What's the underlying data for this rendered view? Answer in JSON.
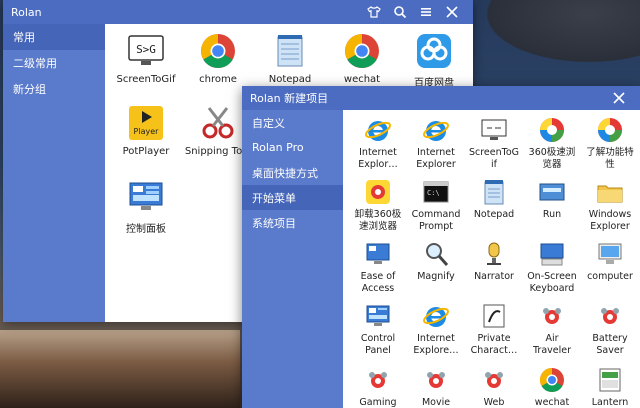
{
  "main_window": {
    "title": "Rolan",
    "sidebar": [
      {
        "label": "常用",
        "active": true
      },
      {
        "label": "二级常用",
        "active": false
      },
      {
        "label": "新分组",
        "active": false
      }
    ],
    "apps": [
      {
        "label": "ScreenToGif",
        "icon": "screentogif-icon"
      },
      {
        "label": "chrome",
        "icon": "chrome-icon"
      },
      {
        "label": "Notepad",
        "icon": "notepad-icon"
      },
      {
        "label": "wechat",
        "icon": "chrome-icon"
      },
      {
        "label": "百度网盘",
        "icon": "baidu-netdisk-icon"
      },
      {
        "label": "PotPlayer",
        "icon": "potplayer-icon"
      },
      {
        "label": "Snipping Tool",
        "icon": "snipping-tool-icon"
      },
      {
        "label": "控制面板",
        "icon": "control-panel-icon"
      }
    ]
  },
  "sub_window": {
    "title": "Rolan 新建项目",
    "sidebar": [
      {
        "label": "自定义",
        "active": false
      },
      {
        "label": "Rolan Pro",
        "active": false
      },
      {
        "label": "桌面快捷方式",
        "active": false
      },
      {
        "label": "开始菜单",
        "active": true
      },
      {
        "label": "系统项目",
        "active": false
      }
    ],
    "items": [
      {
        "label": "Internet\nExplor…",
        "icon": "internet-explorer-icon"
      },
      {
        "label": "Internet\nExplorer",
        "icon": "internet-explorer-icon"
      },
      {
        "label": "ScreenToG\nif",
        "icon": "screentogif-icon"
      },
      {
        "label": "360极速浏\n览器",
        "icon": "360-browser-icon"
      },
      {
        "label": "了解功能特\n性",
        "icon": "360-browser-icon"
      },
      {
        "label": "卸载360极\n速浏览器",
        "icon": "uninstall-icon"
      },
      {
        "label": "Command\nPrompt",
        "icon": "command-prompt-icon"
      },
      {
        "label": "Notepad",
        "icon": "notepad-icon"
      },
      {
        "label": "Run",
        "icon": "run-icon"
      },
      {
        "label": "Windows\nExplorer",
        "icon": "folder-icon"
      },
      {
        "label": "Ease of\nAccess",
        "icon": "ease-of-access-icon"
      },
      {
        "label": "Magnify",
        "icon": "magnify-icon"
      },
      {
        "label": "Narrator",
        "icon": "narrator-icon"
      },
      {
        "label": "On-Screen\nKeyboard",
        "icon": "keyboard-icon"
      },
      {
        "label": "computer",
        "icon": "computer-icon"
      },
      {
        "label": "Control\nPanel",
        "icon": "control-panel-icon"
      },
      {
        "label": "Internet\nExplore…",
        "icon": "internet-explorer-icon"
      },
      {
        "label": "Private\nCharact…",
        "icon": "private-character-icon"
      },
      {
        "label": "Air\nTraveler",
        "icon": "game-icon"
      },
      {
        "label": "Battery\nSaver",
        "icon": "game-icon"
      },
      {
        "label": "Gaming",
        "icon": "game-icon"
      },
      {
        "label": "Movie",
        "icon": "game-icon"
      },
      {
        "label": "Web",
        "icon": "game-icon"
      },
      {
        "label": "wechat",
        "icon": "chrome-icon"
      },
      {
        "label": "Lantern",
        "icon": "lantern-icon"
      }
    ]
  }
}
